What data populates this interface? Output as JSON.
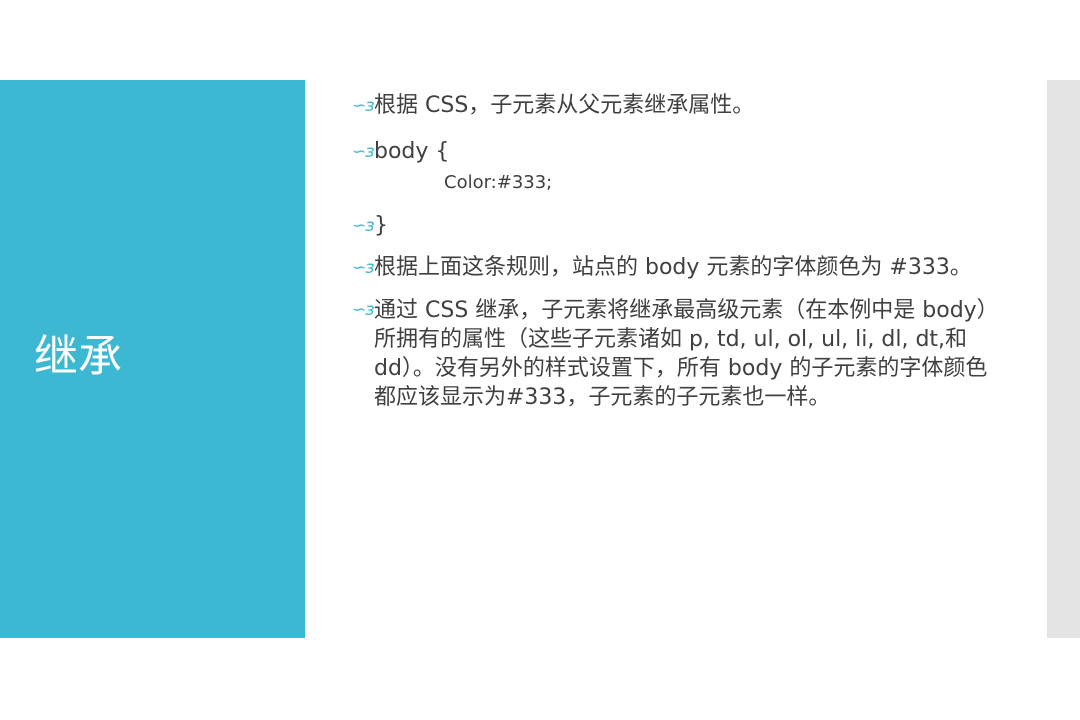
{
  "slide": {
    "title": "继承",
    "bullet_glyph": "∽ɜ",
    "bullets": [
      {
        "text": "根据 CSS，子元素从父元素继承属性。"
      },
      {
        "text": "body {",
        "sub": "Color:#333;"
      },
      {
        "text": "}"
      },
      {
        "text": "根据上面这条规则，站点的 body 元素的字体颜色为 #333。"
      },
      {
        "text": "通过 CSS 继承，子元素将继承最高级元素（在本例中是 body）所拥有的属性（这些子元素诸如 p, td, ul, ol, ul, li, dl, dt,和 dd）。没有另外的样式设置下，所有 body 的子元素的字体颜色都应该显示为#333，子元素的子元素也一样。"
      }
    ]
  },
  "colors": {
    "accent": "#3db8d3",
    "side_bar": "#e4e4e4",
    "text": "#404040",
    "title_text": "#ffffff"
  }
}
